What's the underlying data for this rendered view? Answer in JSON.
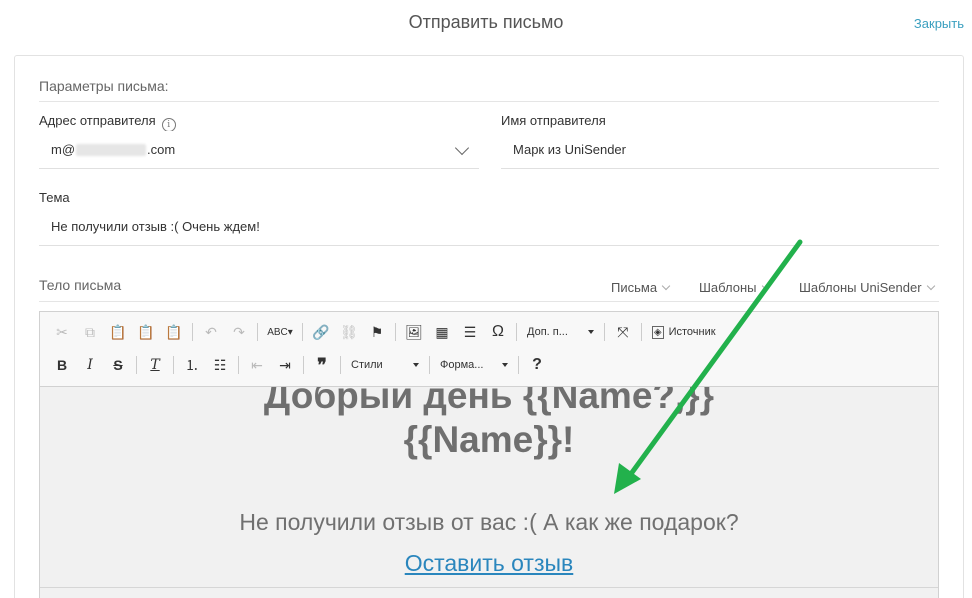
{
  "modal": {
    "title": "Отправить письмо",
    "close_label": "Закрыть"
  },
  "form": {
    "section_title": "Параметры письма:",
    "sender_address": {
      "label": "Адрес отправителя",
      "value_prefix": "m@",
      "value_suffix": ".com"
    },
    "sender_name": {
      "label": "Имя отправителя",
      "value": "Марк из UniSender"
    },
    "subject": {
      "label": "Тема",
      "value": "Не получили отзыв :( Очень ждем!"
    },
    "body": {
      "label": "Тело письма",
      "tabs": [
        {
          "label": "Письма"
        },
        {
          "label": "Шаблоны"
        },
        {
          "label": "Шаблоны UniSender"
        }
      ]
    }
  },
  "toolbar": {
    "extra_combo": "Доп. п...",
    "source_label": "Источник",
    "styles_combo": "Стили",
    "format_combo": "Форма...",
    "help": "?",
    "omega": "Ω"
  },
  "email_content": {
    "greeting_line1": "Добрый день {{Name?,}}",
    "greeting_line2": "{{Name}}!",
    "message": "Не получили отзыв от вас :( А как же подарок?",
    "link_text": "Оставить отзыв"
  },
  "colors": {
    "accent_link": "#3a9fbf",
    "arrow": "#22b14c",
    "content_link": "#2a86bd"
  }
}
